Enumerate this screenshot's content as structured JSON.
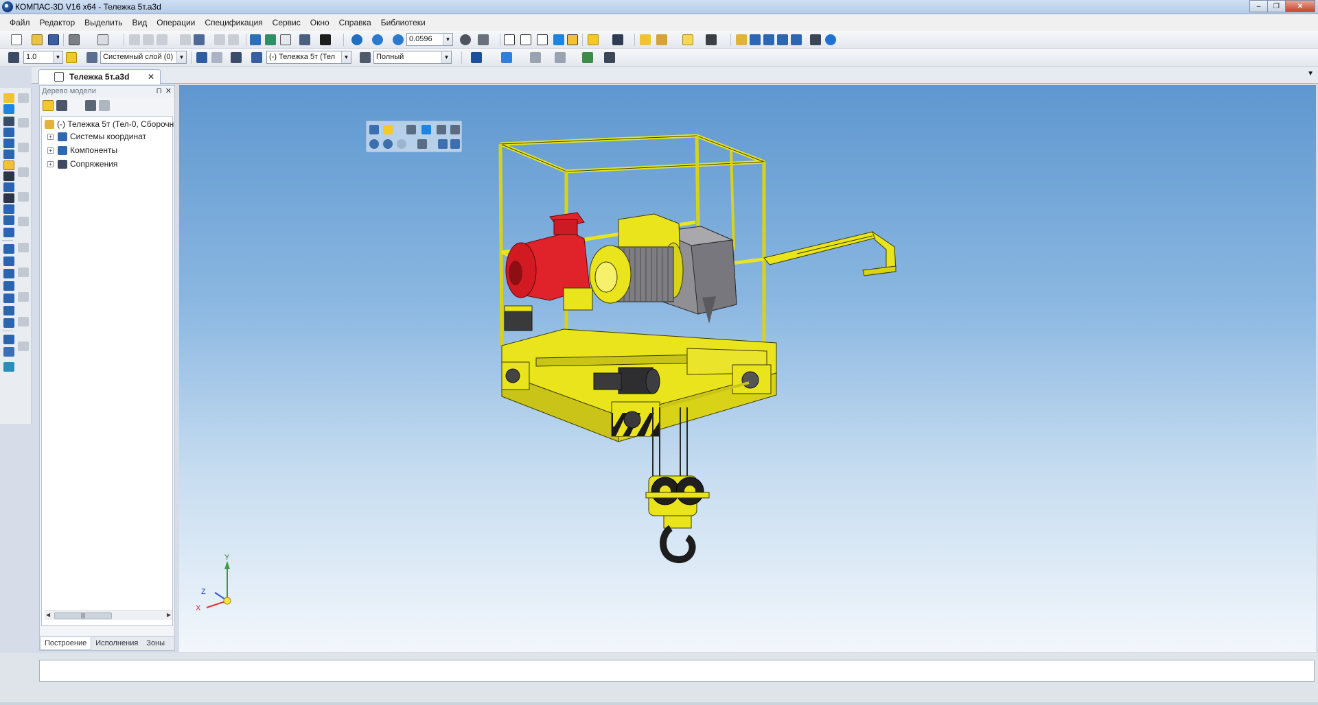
{
  "window": {
    "title": "КОМПАС-3D V16  x64 - Тележка 5т.a3d",
    "minimize": "–",
    "restore": "❐",
    "close": "✕"
  },
  "menu": [
    "Файл",
    "Редактор",
    "Выделить",
    "Вид",
    "Операции",
    "Спецификация",
    "Сервис",
    "Окно",
    "Справка",
    "Библиотеки"
  ],
  "toolbar": {
    "zoom_value": "0.0596",
    "step_value": "1.0",
    "layer_value": "Системный слой (0)",
    "component_value": "(-) Тележка 5т (Тел",
    "display_mode": "Полный"
  },
  "document_tab": {
    "label": "Тележка 5т.a3d",
    "close": "✕"
  },
  "model_tree": {
    "title": "Дерево модели",
    "pin": "⊓",
    "close": "✕",
    "root": "(-) Тележка 5т (Тел-0, Сборочн",
    "children": [
      "Системы координат",
      "Компоненты",
      "Сопряжения"
    ],
    "expander": "+"
  },
  "panel_tabs": [
    "Построение",
    "Исполнения",
    "Зоны"
  ],
  "axes": {
    "x": "X",
    "y": "Y",
    "z": "Z"
  },
  "colors": {
    "frame_yellow": "#e9e41c",
    "motor_red": "#e0222a",
    "gearbox_gray": "#8f8f94",
    "viewport_top": "#5e97cf",
    "viewport_bottom": "#f3f7fc"
  },
  "icons": [
    "new-file-icon",
    "open-icon",
    "save-icon",
    "print-icon",
    "undo-icon",
    "redo-icon",
    "zoom-icon",
    "rotate-icon",
    "help-icon"
  ]
}
